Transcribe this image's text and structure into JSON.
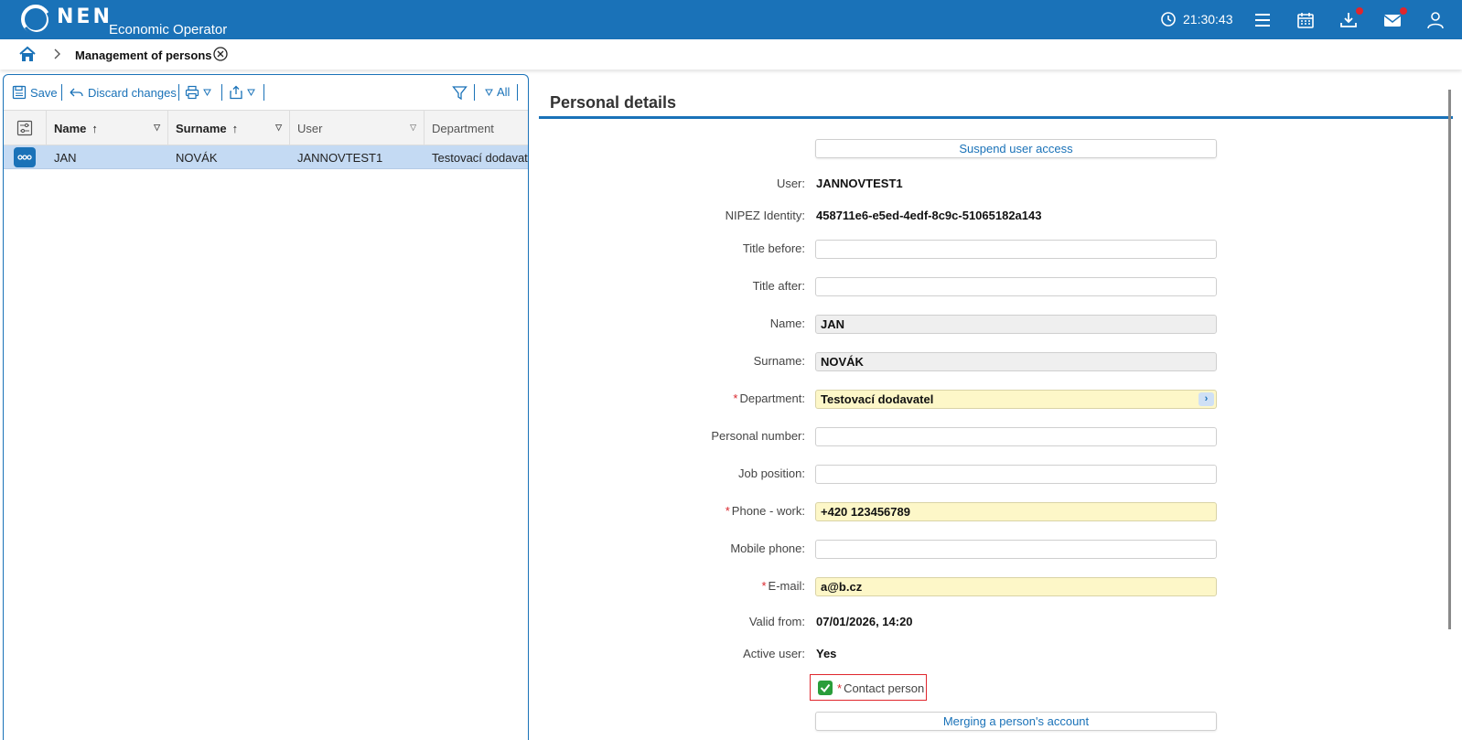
{
  "header": {
    "brand": "NEN",
    "subtitle": "Economic Operator",
    "time": "21:30:43",
    "colors": {
      "bar": "#1a72b8",
      "notification": "#e0262d"
    }
  },
  "breadcrumb": {
    "current": "Management of persons"
  },
  "toolbar": {
    "save_label": "Save",
    "discard_label": "Discard changes",
    "filter_all_label": "All"
  },
  "grid": {
    "columns": [
      {
        "label": "Name",
        "sorted": "ascending"
      },
      {
        "label": "Surname",
        "sorted": "ascending"
      },
      {
        "label": "User"
      },
      {
        "label": "Department"
      }
    ],
    "rows": [
      {
        "name": "JAN",
        "surname": "NOVÁK",
        "user": "JANNOVTEST1",
        "department": "Testovací dodavatel"
      }
    ]
  },
  "details": {
    "title": "Personal details",
    "suspend_button": "Suspend user access",
    "user_label": "User:",
    "user_value": "JANNOVTEST1",
    "nipez_label": "NIPEZ Identity:",
    "nipez_value": "458711e6-e5ed-4edf-8c9c-51065182a143",
    "title_before_label": "Title before:",
    "title_before_value": "",
    "title_after_label": "Title after:",
    "title_after_value": "",
    "name_label": "Name:",
    "name_value": "JAN",
    "surname_label": "Surname:",
    "surname_value": "NOVÁK",
    "department_label": "Department:",
    "department_value": "Testovací dodavatel",
    "personal_number_label": "Personal number:",
    "personal_number_value": "",
    "job_position_label": "Job position:",
    "job_position_value": "",
    "phone_work_label": "Phone - work:",
    "phone_work_value": "+420 123456789",
    "mobile_phone_label": "Mobile phone:",
    "mobile_phone_value": "",
    "email_label": "E-mail:",
    "email_value": "a@b.cz",
    "valid_from_label": "Valid from:",
    "valid_from_value": "07/01/2026, 14:20",
    "active_user_label": "Active user:",
    "active_user_value": "Yes",
    "contact_person_label": "Contact person",
    "contact_person_checked": true,
    "merge_button": "Merging a person's account",
    "required_marker": "*"
  }
}
